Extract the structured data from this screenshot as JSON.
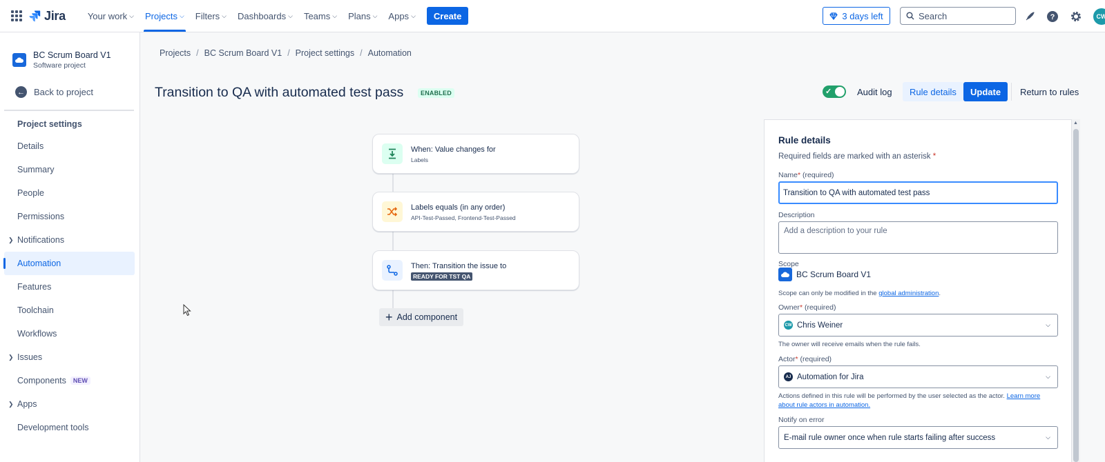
{
  "topnav": {
    "logo_text": "Jira",
    "items": [
      {
        "label": "Your work",
        "active": false
      },
      {
        "label": "Projects",
        "active": true
      },
      {
        "label": "Filters",
        "active": false
      },
      {
        "label": "Dashboards",
        "active": false
      },
      {
        "label": "Teams",
        "active": false
      },
      {
        "label": "Plans",
        "active": false
      },
      {
        "label": "Apps",
        "active": false
      }
    ],
    "create_label": "Create",
    "trial_label": "3 days left",
    "search_placeholder": "Search",
    "avatar_initials": "CW"
  },
  "sidebar": {
    "project_name": "BC Scrum Board V1",
    "project_type": "Software project",
    "back_label": "Back to project",
    "heading": "Project settings",
    "items": [
      {
        "label": "Details"
      },
      {
        "label": "Summary"
      },
      {
        "label": "People"
      },
      {
        "label": "Permissions"
      },
      {
        "label": "Notifications",
        "expandable": true
      },
      {
        "label": "Automation",
        "selected": true
      },
      {
        "label": "Features"
      },
      {
        "label": "Toolchain"
      },
      {
        "label": "Workflows"
      },
      {
        "label": "Issues",
        "expandable": true
      },
      {
        "label": "Components",
        "badge": "NEW"
      },
      {
        "label": "Apps",
        "expandable": true
      },
      {
        "label": "Development tools"
      }
    ]
  },
  "breadcrumb": [
    "Projects",
    "BC Scrum Board V1",
    "Project settings",
    "Automation"
  ],
  "rule": {
    "title": "Transition to QA with automated test pass",
    "status": "ENABLED",
    "enabled": true
  },
  "header_buttons": {
    "audit_log": "Audit log",
    "rule_details": "Rule details",
    "update": "Update",
    "return": "Return to rules"
  },
  "flow": {
    "trigger": {
      "title": "When: Value changes for",
      "subtitle": "Labels"
    },
    "condition": {
      "title": "Labels equals (in any order)",
      "subtitle": "API-Test-Passed, Frontend-Test-Passed"
    },
    "action": {
      "title": "Then: Transition the issue to",
      "status": "READY FOR TST QA"
    },
    "add_label": "Add component"
  },
  "panel": {
    "title": "Rule details",
    "required_note": "Required fields are marked with an asterisk",
    "name_label": "Name",
    "name_required": " (required)",
    "name_value": "Transition to QA with automated test pass",
    "description_label": "Description",
    "description_placeholder": "Add a description to your rule",
    "scope_label": "Scope",
    "scope_value": "BC Scrum Board V1",
    "scope_help": "Scope can only be modified in the ",
    "scope_help_link": "global administration",
    "owner_label": "Owner",
    "owner_required": " (required)",
    "owner_value": "Chris Weiner",
    "owner_initials": "CW",
    "owner_help": "The owner will receive emails when the rule fails.",
    "actor_label": "Actor",
    "actor_required": " (required)",
    "actor_value": "Automation for Jira",
    "actor_initials": "AJ",
    "actor_help": "Actions defined in this rule will be performed by the user selected as the actor. ",
    "actor_help_link": "Learn more about rule actors in automation.",
    "notify_label": "Notify on error",
    "notify_value": "E-mail rule owner once when rule starts failing after success"
  },
  "colors": {
    "brand_blue": "#0c66e4",
    "enabled_green": "#22a06b",
    "sidebar_selected_bg": "#e9f2ff"
  }
}
